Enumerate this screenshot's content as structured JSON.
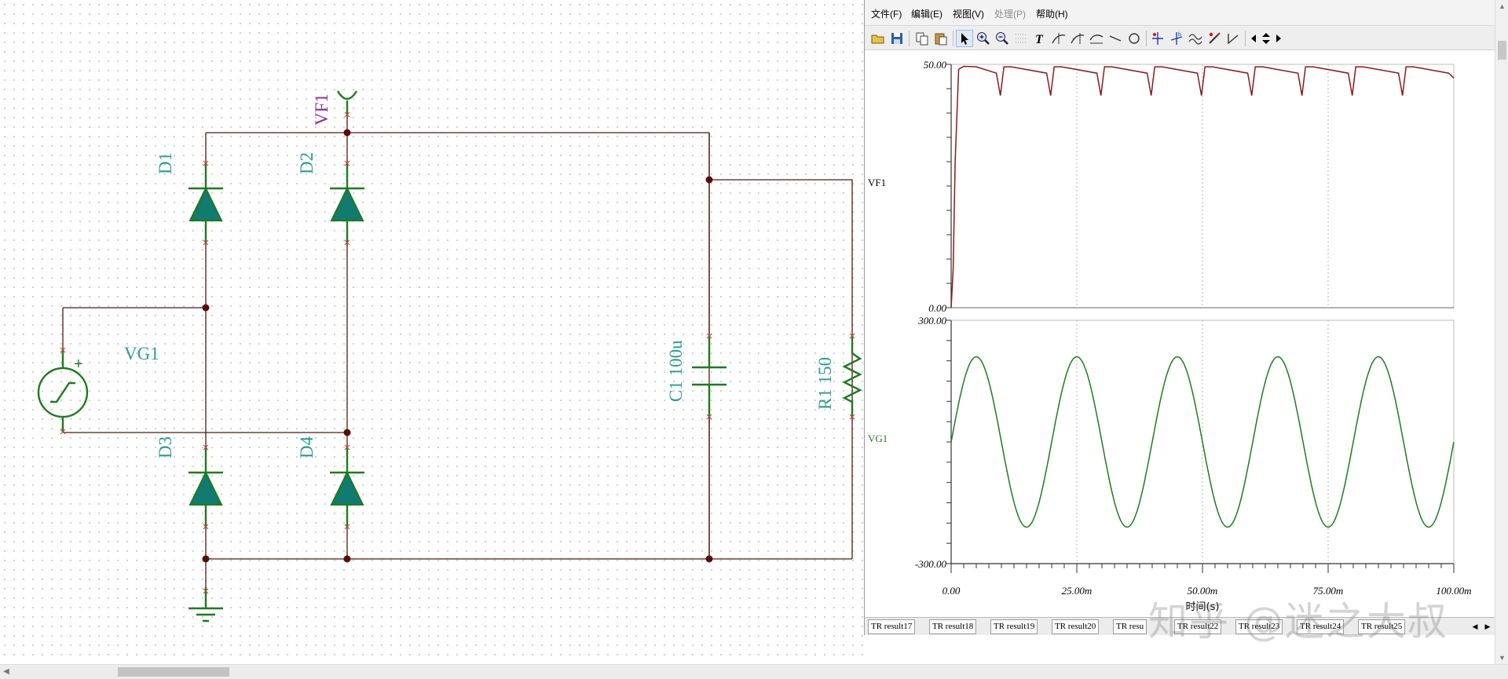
{
  "schematic": {
    "components": {
      "d1": "D1",
      "d2": "D2",
      "d3": "D3",
      "d4": "D4",
      "c1": "C1 100u",
      "r1": "R1 150",
      "vg1": "VG1",
      "vf1": "VF1",
      "plus": "+"
    }
  },
  "grapher": {
    "menu": {
      "file": "文件(F)",
      "edit": "编辑(E)",
      "view": "视图(V)",
      "process": "处理(P)",
      "help": "帮助(H)"
    },
    "toolbar_icons": [
      "open-icon",
      "save-icon",
      "copy-icon",
      "paste-icon",
      "pointer-icon",
      "zoom-in-icon",
      "zoom-out-icon",
      "grid-icon",
      "text-icon",
      "cursor-a-icon",
      "cursor-b-icon",
      "cursor-c-icon",
      "line-icon",
      "circle-icon",
      "marker-a-icon",
      "marker-b-icon",
      "waveform-icon",
      "probe-icon",
      "step-icon",
      "prev-icon",
      "updown-icon",
      "next-icon"
    ],
    "plots": [
      {
        "signal": "VF1",
        "color": "#8b1a1a",
        "ymin_label": "0.00",
        "ymax_label": "50.00"
      },
      {
        "signal": "VG1",
        "color": "#1e7d1e",
        "ymin_label": "-300.00",
        "ymax_label": "300.00"
      }
    ],
    "x_axis": {
      "tick_labels": [
        "0.00",
        "25.00m",
        "50.00m",
        "75.00m",
        "100.00m"
      ],
      "label": "时间(s)"
    },
    "tabs": [
      "TR result17",
      "TR result18",
      "TR result19",
      "TR result20",
      "TR resu",
      "TR result22",
      "TR result23",
      "TR result24",
      "TR result25"
    ]
  },
  "chart_data": [
    {
      "type": "line",
      "title": "",
      "series": [
        {
          "name": "VF1",
          "color": "#8b1a1a"
        }
      ],
      "description_points": {
        "x": [
          0,
          0.4,
          0.8,
          1.5,
          2.5,
          5,
          9,
          9.8,
          10.5,
          12,
          19,
          19.8,
          20.5,
          22,
          29,
          29.8,
          30.5,
          32,
          39,
          39.8,
          40.5,
          42,
          49,
          49.8,
          50.5,
          52,
          59,
          59.8,
          60.5,
          62,
          69,
          69.8,
          70.5,
          72,
          79,
          79.8,
          80.5,
          82,
          89,
          89.8,
          90.5,
          92,
          99,
          100
        ],
        "y": [
          0,
          8,
          30,
          49,
          49.6,
          49.5,
          48.2,
          43.6,
          49.5,
          49.5,
          48.2,
          43.6,
          49.5,
          49.5,
          48.2,
          43.6,
          49.5,
          49.5,
          48.2,
          43.6,
          49.5,
          49.5,
          48.2,
          43.6,
          49.5,
          49.5,
          48.2,
          43.6,
          49.5,
          49.5,
          48.2,
          43.6,
          49.5,
          49.5,
          48.2,
          43.6,
          49.5,
          49.5,
          48.2,
          43.6,
          49.5,
          49.5,
          48.2,
          47.2
        ]
      },
      "x_unit": "ms",
      "xlim": [
        0,
        100
      ],
      "ylim": [
        0,
        50
      ],
      "grid": "vertical dashed"
    },
    {
      "type": "line",
      "title": "",
      "series": [
        {
          "name": "VG1",
          "color": "#1e7d1e"
        }
      ],
      "waveform": {
        "shape": "sine",
        "amplitude": 210,
        "frequency_hz": 50,
        "phase_deg": 0
      },
      "x_unit": "ms",
      "xlim": [
        0,
        100
      ],
      "ylim": [
        -300,
        300
      ],
      "grid": "vertical dashed"
    }
  ],
  "watermark": "知乎 @迷之大叔"
}
